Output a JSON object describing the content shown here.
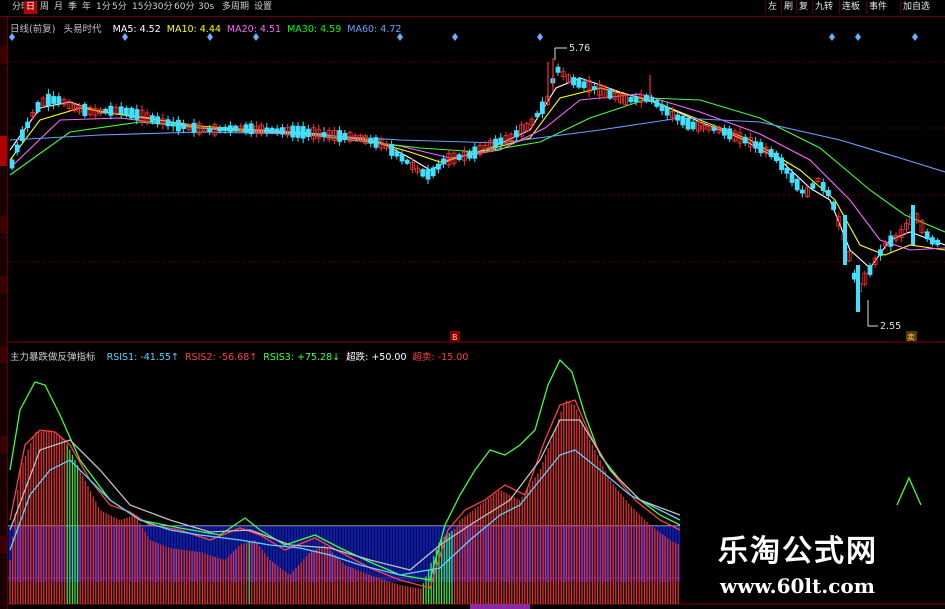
{
  "toolbar": {
    "left_items": [
      "分时",
      "日",
      "周",
      "月",
      "季",
      "年",
      "1分",
      "5分",
      "15分",
      "30分",
      "60分",
      "30s",
      "多周期",
      "设置"
    ],
    "active_index": 1,
    "right_items": [
      "左",
      "刷",
      "复",
      "九转",
      "连板",
      "事件",
      "加自选"
    ]
  },
  "main_panel": {
    "indicator_name": "日线(前复)",
    "formula_name": "头易时代",
    "ma": [
      {
        "label": "MA5: 4.52",
        "color": "#ffffff"
      },
      {
        "label": "MA10: 4.44",
        "color": "#ffff00"
      },
      {
        "label": "MA20: 4.51",
        "color": "#ff66ff"
      },
      {
        "label": "MA30: 4.59",
        "color": "#00ff00"
      },
      {
        "label": "MA60: 4.72",
        "color": "#6aa0ff"
      }
    ],
    "high_label": "5.76",
    "low_label": "2.55",
    "marker_b": "B",
    "marker_s": "卖"
  },
  "sub_panel": {
    "formula_name": "主力暴跌做反弹指标",
    "values": [
      {
        "label": "RSIS1: -41.55",
        "arrow": "↑",
        "color": "#5fd0ff"
      },
      {
        "label": "RSIS2: -56.68",
        "arrow": "↑",
        "color": "#ff4040"
      },
      {
        "label": "RSIS3: +75.28",
        "arrow": "↓",
        "color": "#40ff40"
      },
      {
        "label": "超跌: +50.00",
        "arrow": "",
        "color": "#ffffff"
      },
      {
        "label": "超卖: -15.00",
        "arrow": "",
        "color": "#ff4040"
      }
    ]
  },
  "watermark": {
    "title": "乐淘公式网",
    "url": "www.60lt.com"
  }
}
